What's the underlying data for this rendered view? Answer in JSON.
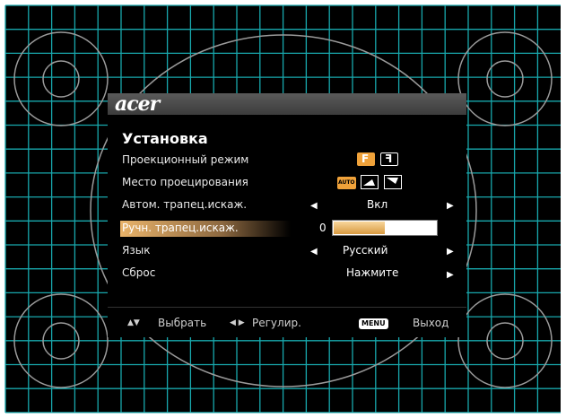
{
  "brand": "acer",
  "menu_title": "Установка",
  "rows": [
    {
      "label": "Проекционный режим"
    },
    {
      "label": "Место проецирования"
    },
    {
      "label": "Автом. трапец.искаж.",
      "value": "Вкл"
    },
    {
      "label": "Ручн. трапец.искаж.",
      "value": "0",
      "level": 0.5
    },
    {
      "label": "Язык",
      "value": "Русский"
    },
    {
      "label": "Сброс",
      "value": "Нажмите"
    }
  ],
  "projection_icons": {
    "front": "F",
    "rear": "F"
  },
  "location_icons": {
    "auto": "AUTO"
  },
  "footer": {
    "select": "Выбрать",
    "adjust": "Регулир.",
    "menu_key": "MENU",
    "exit": "Выход"
  },
  "colors": {
    "grid_line": "#18a8ad",
    "highlight": "#e9b36a",
    "icon_orange": "#f0a23a"
  }
}
